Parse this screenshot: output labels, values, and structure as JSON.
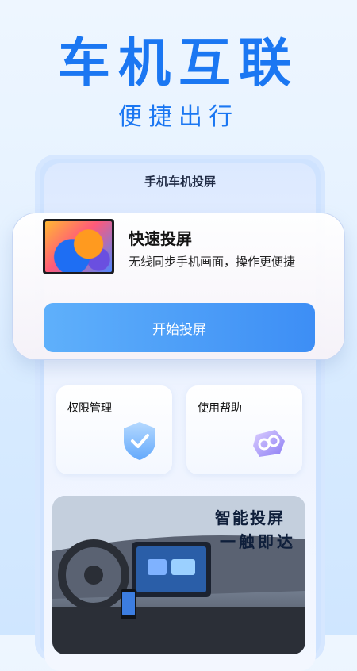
{
  "hero": {
    "title": "车机互联",
    "subtitle": "便捷出行"
  },
  "phone": {
    "title": "手机车机投屏"
  },
  "cast_card": {
    "title": "快速投屏",
    "description": "无线同步手机画面，操作更便捷",
    "button_label": "开始投屏",
    "button_gradient": [
      "#5fb0fb",
      "#3d8ef5"
    ]
  },
  "features": [
    {
      "label": "权限管理",
      "icon": "shield-check-icon"
    },
    {
      "label": "使用帮助",
      "icon": "link-icon"
    }
  ],
  "banner": {
    "line1": "智能投屏",
    "line2": "一触即达",
    "image": "car-interior-dashboard"
  },
  "colors": {
    "brand": "#1b77f2",
    "text": "#141414"
  }
}
